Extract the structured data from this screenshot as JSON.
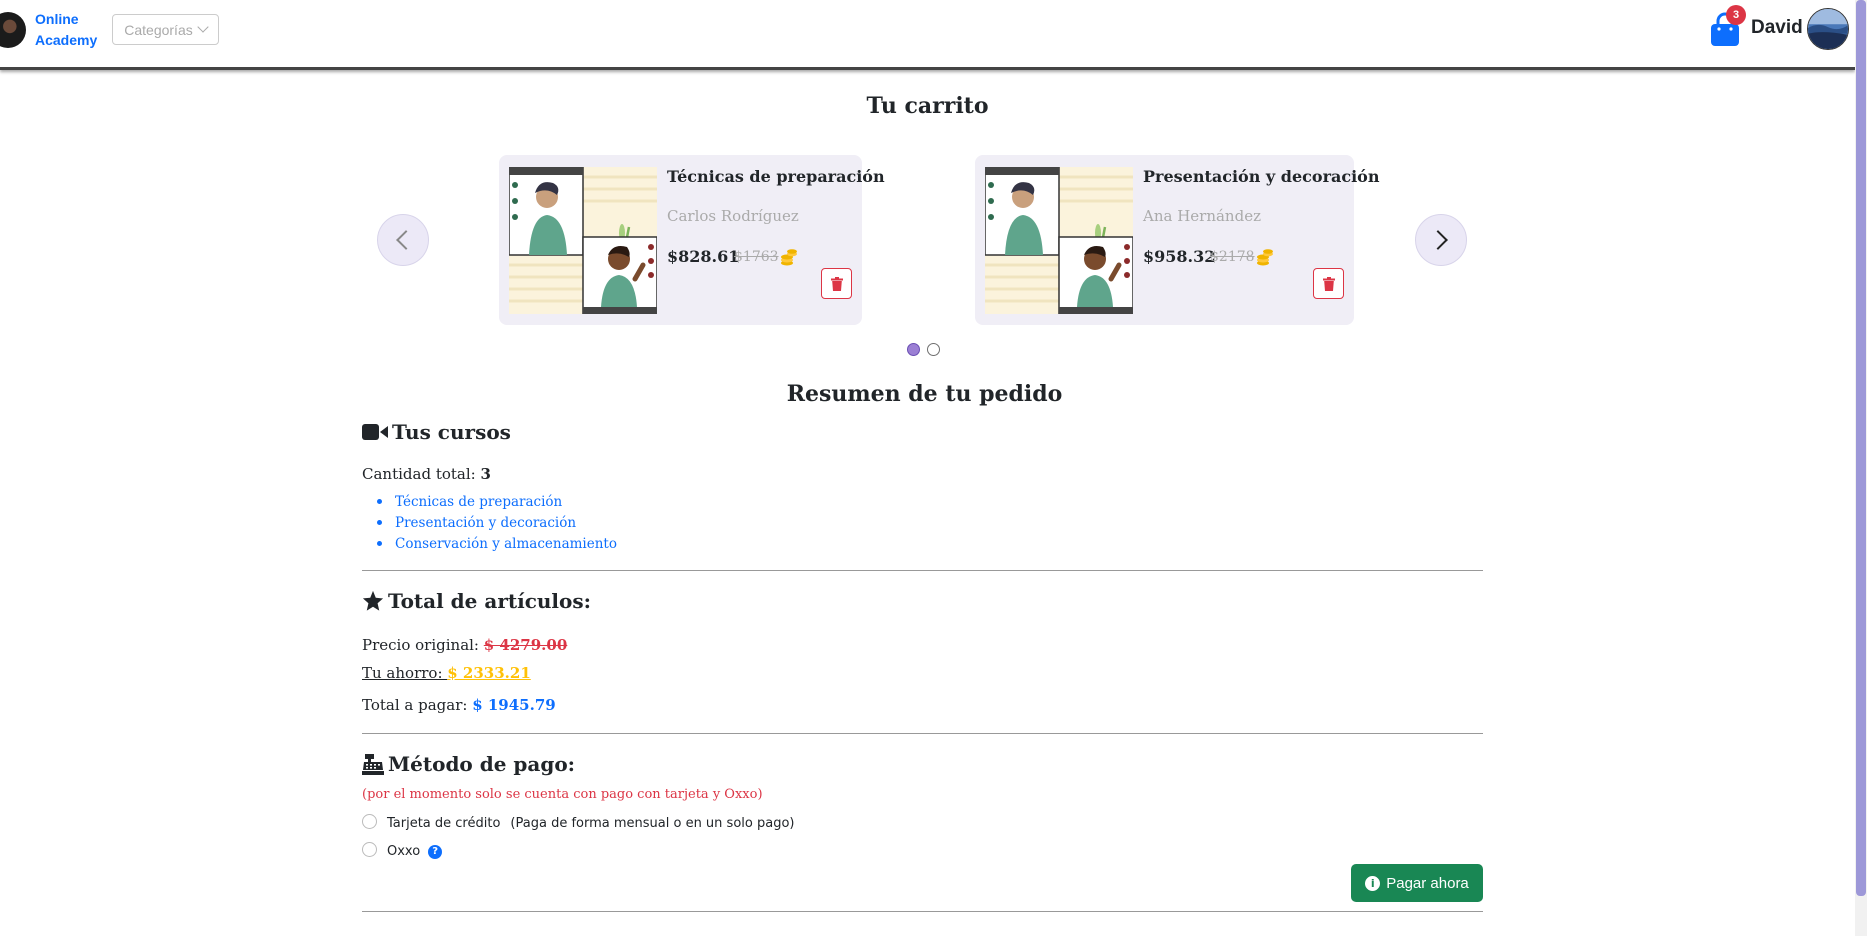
{
  "navbar": {
    "brand_line1": "Online",
    "brand_line2": "Academy",
    "categories_label": "Categorías",
    "cart_count": "3",
    "user_name": "David"
  },
  "cart": {
    "title": "Tu carrito",
    "items": [
      {
        "title": "Técnicas de preparación",
        "author": "Carlos Rodríguez",
        "price": "$828.61",
        "old_price": "$1763"
      },
      {
        "title": "Presentación y decoración",
        "author": "Ana Hernández",
        "price": "$958.32",
        "old_price": "$2178"
      }
    ],
    "carousel_pages": 2,
    "active_page": 1
  },
  "summary": {
    "title": "Resumen de tu pedido",
    "courses_heading": "Tus cursos",
    "quantity_label": "Cantidad total: ",
    "quantity_value": "3",
    "course_list": [
      "Técnicas de preparación",
      "Presentación y decoración",
      "Conservación y almacenamiento"
    ],
    "totals_heading": "Total de artículos:",
    "original_label": "Precio original: ",
    "original_value": "$ 4279.00",
    "savings_label": "Tu ahorro: ",
    "savings_value": "$ 2333.21",
    "total_label": "Total a pagar: ",
    "total_value": "$ 1945.79",
    "payment_heading": "Método de pago:",
    "payment_note": "(por el momento solo se cuenta con pago con tarjeta y Oxxo)",
    "option_card": "Tarjeta de crédito",
    "option_card_desc": "(Paga de forma mensual o en un solo pago)",
    "option_oxxo": "Oxxo",
    "pay_button": "Pagar ahora"
  },
  "colors": {
    "accent": "#0d6efd",
    "danger": "#dc3545",
    "warning": "#ffc107",
    "success": "#198754",
    "scrollbar": "#9d98d8"
  },
  "icons": {
    "cart": "shopping-bag-icon",
    "delete": "trash-icon",
    "courses": "video-camera-icon",
    "totals": "star-icon",
    "payment": "cash-register-icon",
    "help": "question-circle-icon",
    "pay": "info-circle-icon",
    "coins": "coins-icon"
  }
}
